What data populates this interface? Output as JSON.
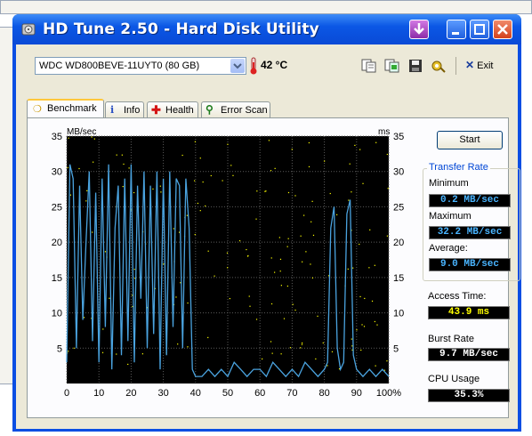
{
  "window": {
    "title": "HD Tune 2.50 - Hard Disk Utility"
  },
  "toolbar": {
    "drive": "WDC WD800BEVE-11UYT0 (80 GB)",
    "temperature": "42 °C",
    "exit_label": "Exit",
    "icons": [
      "copy-text-icon",
      "copy-screenshot-icon",
      "save-icon",
      "options-icon"
    ]
  },
  "tabs": [
    {
      "label": "Benchmark",
      "icon": "benchmark-icon",
      "active": true
    },
    {
      "label": "Info",
      "icon": "info-icon",
      "active": false
    },
    {
      "label": "Health",
      "icon": "health-icon",
      "active": false
    },
    {
      "label": "Error Scan",
      "icon": "error-scan-icon",
      "active": false
    }
  ],
  "benchmark": {
    "start_label": "Start",
    "transfer_rate": {
      "title": "Transfer Rate",
      "minimum_label": "Minimum",
      "minimum": "0.2 MB/sec",
      "maximum_label": "Maximum",
      "maximum": "32.2 MB/sec",
      "average_label": "Average:",
      "average": "9.0 MB/sec"
    },
    "access_time_label": "Access Time:",
    "access_time": "43.9 ms",
    "burst_rate_label": "Burst Rate",
    "burst_rate": "9.7 MB/sec",
    "cpu_label": "CPU Usage",
    "cpu_usage": "35.3%"
  },
  "colors": {
    "transfer_line": "#4aa3df",
    "access_dots": "#ffff00",
    "plot_bg": "#000000",
    "grid": "#5a5a5a"
  },
  "chart_data": {
    "type": "line",
    "xlabel": "",
    "ylabel_left": "MB/sec",
    "ylabel_right": "ms",
    "xlim": [
      0,
      100
    ],
    "ylim": [
      0,
      35
    ],
    "x_ticks": [
      "0",
      "10",
      "20",
      "30",
      "40",
      "50",
      "60",
      "70",
      "80",
      "90",
      "100%"
    ],
    "y_ticks": [
      "5",
      "10",
      "15",
      "20",
      "25",
      "30",
      "35"
    ],
    "y_ticks_right": [
      "5",
      "10",
      "15",
      "20",
      "25",
      "30",
      "35"
    ],
    "grid": true,
    "series": [
      {
        "x": [
          0,
          1,
          2,
          3,
          4,
          5,
          6,
          7,
          8,
          9,
          10,
          11,
          12,
          13,
          14,
          15,
          16,
          17,
          18,
          19,
          20,
          21,
          22,
          23,
          24,
          25,
          26,
          27,
          28,
          29,
          30,
          31,
          32,
          33,
          34,
          35,
          36,
          37,
          38,
          39,
          40,
          42,
          44,
          46,
          48,
          50,
          52,
          54,
          56,
          58,
          60,
          62,
          64,
          66,
          68,
          70,
          72,
          74,
          76,
          78,
          80,
          81,
          82,
          83,
          84,
          85,
          86,
          87,
          88,
          89,
          90,
          92,
          94,
          96,
          98,
          100
        ],
        "y": [
          3,
          31,
          29,
          5,
          28,
          9,
          20,
          30,
          6,
          27,
          3,
          29,
          8,
          31,
          2,
          22,
          28,
          4,
          29,
          6,
          31,
          3,
          28,
          12,
          30,
          5,
          28,
          7,
          30,
          2,
          29,
          4,
          30,
          8,
          29,
          28,
          5,
          29,
          22,
          2,
          1,
          1,
          2,
          1,
          2,
          1,
          3,
          2,
          1,
          2,
          2,
          1,
          3,
          2,
          1,
          2,
          1,
          3,
          2,
          1,
          2,
          3,
          22,
          25,
          5,
          2,
          3,
          24,
          26,
          4,
          2,
          1,
          2,
          1,
          2,
          1
        ]
      }
    ]
  }
}
